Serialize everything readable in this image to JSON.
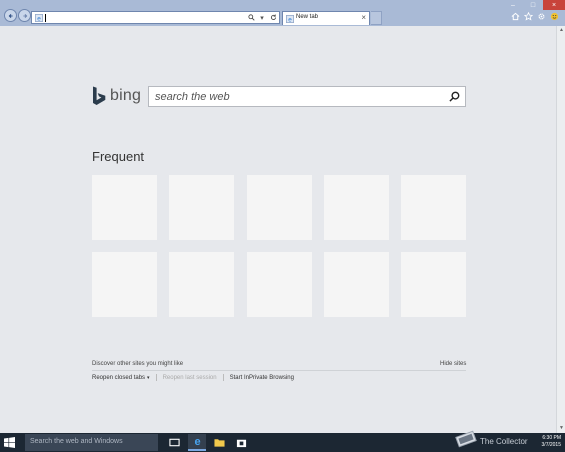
{
  "browser": {
    "address_value": "",
    "tab_title": "New tab",
    "tab_close": "×",
    "window_buttons": [
      "–",
      "□",
      "×"
    ],
    "toolbar_icons": [
      "home-icon",
      "star-icon",
      "gear-icon",
      "smiley-icon"
    ]
  },
  "page": {
    "logo_text": "bing",
    "search_placeholder": "search the web",
    "frequent_title": "Frequent",
    "tile_count": 10,
    "discover_text": "Discover other sites you might like",
    "hide_sites": "Hide sites",
    "reopen_closed_tabs": "Reopen closed tabs",
    "reopen_dropdown": "▾",
    "reopen_last_session": "Reopen last session",
    "start_inprivate": "Start InPrivate Browsing"
  },
  "taskbar": {
    "search_placeholder": "Search the web and Windows",
    "clock_time": "6:30 PM",
    "clock_date": "3/7/2015",
    "watermark": "The Collector"
  },
  "colors": {
    "chrome": "#a9bad6",
    "page_bg": "#e6e8ec",
    "tile": "#f5f5f5",
    "taskbar": "#1c2733"
  }
}
